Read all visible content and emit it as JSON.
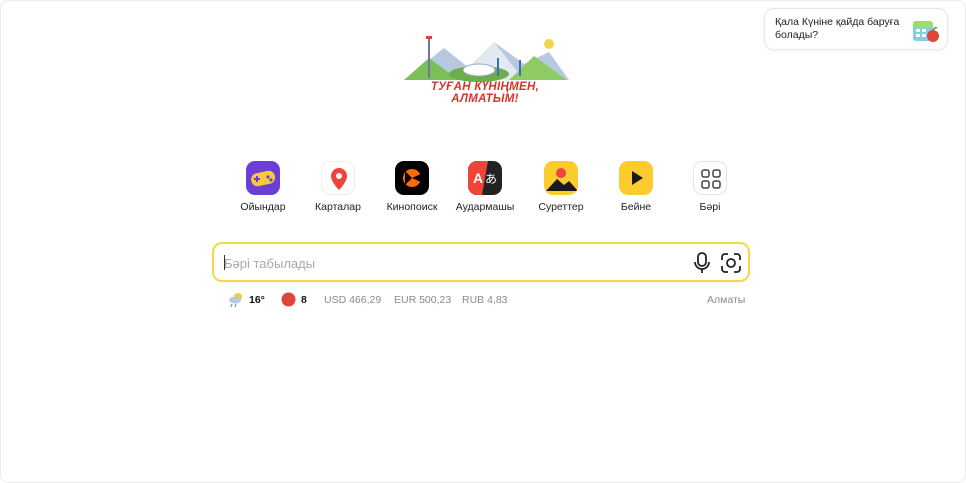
{
  "promo": {
    "text": "Қала Күніне қайда баруға болады?",
    "icon": "calendar-apple-icon"
  },
  "logo": {
    "caption": "ТУҒАН КҮНІҢМЕН, АЛМАТЫМ!"
  },
  "services": [
    {
      "label": "Ойындар",
      "icon": "games-icon"
    },
    {
      "label": "Карталар",
      "icon": "maps-icon"
    },
    {
      "label": "Кинопоиск",
      "icon": "kinopoisk-icon"
    },
    {
      "label": "Аудармашы",
      "icon": "translate-icon"
    },
    {
      "label": "Суреттер",
      "icon": "images-icon"
    },
    {
      "label": "Бейне",
      "icon": "video-icon"
    },
    {
      "label": "Бәрі",
      "icon": "all-services-icon"
    }
  ],
  "search": {
    "placeholder": "Бәрі табылады"
  },
  "info": {
    "weather": "16°",
    "traffic": "8",
    "usd": "USD 466,29",
    "eur": "EUR 500,23",
    "rub": "RUB 4,83",
    "city": "Алматы"
  },
  "colors": {
    "search_border": "#f5d84a",
    "caption_red": "#d8332b"
  }
}
